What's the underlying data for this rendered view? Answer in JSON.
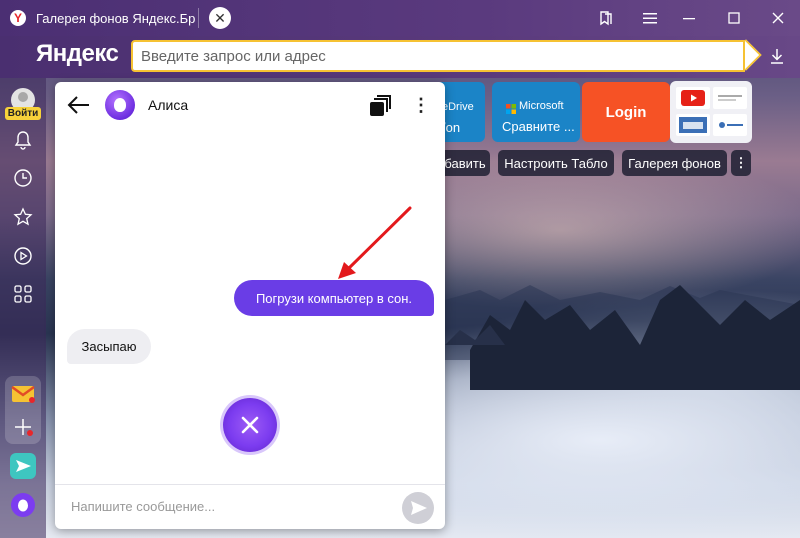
{
  "browser": {
    "tab_title": "Галерея фонов Яндекс.Бра",
    "brand": "Яндекс",
    "address_placeholder": "Введите запрос или адрес"
  },
  "sidebar": {
    "login_label": "Войти"
  },
  "tiles": {
    "onedrive_partial": "eDrive",
    "onedrive_sub": "/on",
    "microsoft_title": "Microsoft",
    "microsoft_sub": "Сравните ...",
    "login": "Login"
  },
  "tableau_buttons": {
    "add_partial": "бавить",
    "customize": "Настроить Табло",
    "gallery": "Галерея фонов"
  },
  "alice": {
    "title": "Алиса",
    "user_message": "Погрузи компьютер в сон.",
    "reply": "Засыпаю",
    "input_placeholder": "Напишите сообщение..."
  },
  "colors": {
    "accent_purple": "#6a3de6",
    "address_border": "#f6c233",
    "annotation_arrow": "#e3191c"
  }
}
